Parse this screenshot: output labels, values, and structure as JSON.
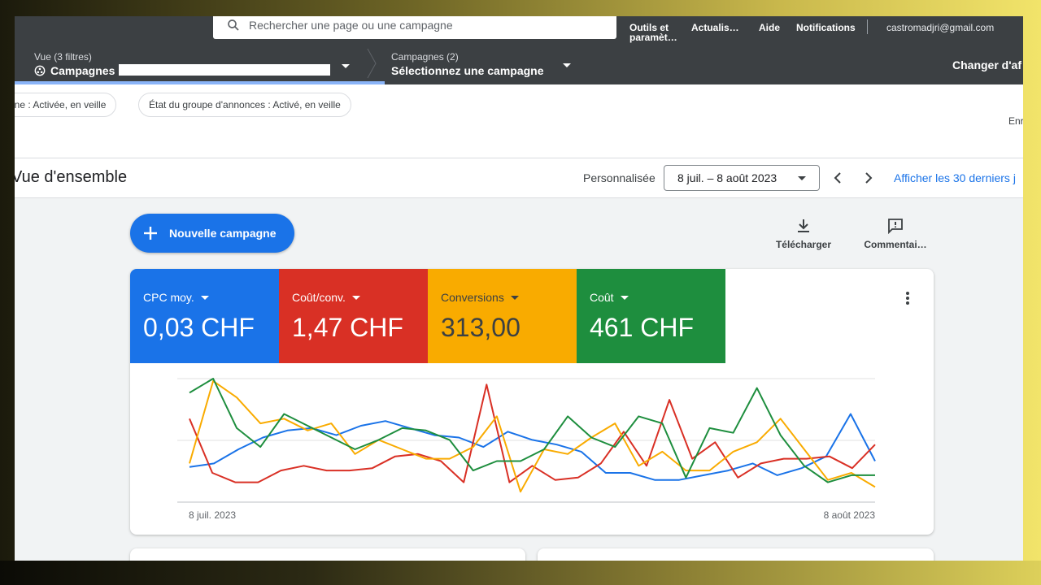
{
  "topbar": {
    "search_placeholder": "Rechercher une page ou une campagne",
    "tools": "Outils et paramèt…",
    "refresh": "Actualis…",
    "help": "Aide",
    "notifications": "Notifications",
    "account_email": "castromadjri@gmail.com"
  },
  "nav": {
    "view_label": "Vue (3 filtres)",
    "view_value": "Campagnes",
    "campaigns_label": "Campagnes (2)",
    "campaigns_value": "Sélectionnez une campagne",
    "change_view": "Changer d'af"
  },
  "filters": {
    "chip1": "gne : Activée, en veille",
    "chip2": "État du groupe d'annonces : Activé, en veille",
    "save_partial": "Enr"
  },
  "overview": {
    "title": "Vue d'ensemble",
    "custom_label": "Personnalisée",
    "date_range": "8 juil. – 8 août 2023",
    "last30": "Afficher les 30 derniers j"
  },
  "actions": {
    "new_campaign": "Nouvelle campagne",
    "download": "Télécharger",
    "feedback": "Commentai…"
  },
  "metrics": [
    {
      "label": "CPC moy.",
      "value": "0,03 CHF",
      "color": "#1a73e8"
    },
    {
      "label": "Coût/conv.",
      "value": "1,47 CHF",
      "color": "#d93025"
    },
    {
      "label": "Conversions",
      "value": "313,00",
      "color": "#f9ab00"
    },
    {
      "label": "Coût",
      "value": "461 CHF",
      "color": "#1e8e3e"
    }
  ],
  "chart_data": {
    "type": "line",
    "x_start_label": "8 juil. 2023",
    "x_end_label": "8 août 2023",
    "series": [
      {
        "color": "#1a73e8",
        "values": [
          0.25,
          0.28,
          0.4,
          0.5,
          0.56,
          0.58,
          0.52,
          0.6,
          0.64,
          0.58,
          0.52,
          0.5,
          0.42,
          0.55,
          0.48,
          0.44,
          0.38,
          0.2,
          0.2,
          0.14,
          0.14,
          0.18,
          0.22,
          0.28,
          0.18,
          0.24,
          0.34,
          0.7,
          0.3
        ]
      },
      {
        "color": "#d93025",
        "values": [
          0.66,
          0.2,
          0.12,
          0.12,
          0.22,
          0.26,
          0.22,
          0.22,
          0.24,
          0.34,
          0.36,
          0.3,
          0.12,
          0.95,
          0.12,
          0.26,
          0.14,
          0.16,
          0.28,
          0.55,
          0.26,
          0.82,
          0.32,
          0.46,
          0.16,
          0.28,
          0.32,
          0.32,
          0.34,
          0.24,
          0.44
        ]
      },
      {
        "color": "#f9ab00",
        "values": [
          0.28,
          0.98,
          0.84,
          0.62,
          0.66,
          0.56,
          0.62,
          0.36,
          0.48,
          0.4,
          0.32,
          0.32,
          0.42,
          0.68,
          0.04,
          0.4,
          0.36,
          0.5,
          0.62,
          0.26,
          0.38,
          0.22,
          0.22,
          0.38,
          0.46,
          0.66,
          0.4,
          0.14,
          0.2,
          0.08
        ]
      },
      {
        "color": "#1e8e3e",
        "values": [
          0.88,
          1.0,
          0.58,
          0.42,
          0.7,
          0.6,
          0.5,
          0.4,
          0.48,
          0.58,
          0.56,
          0.48,
          0.22,
          0.3,
          0.3,
          0.4,
          0.68,
          0.5,
          0.42,
          0.68,
          0.62,
          0.16,
          0.58,
          0.54,
          0.92,
          0.52,
          0.26,
          0.12,
          0.18,
          0.18
        ]
      }
    ]
  }
}
